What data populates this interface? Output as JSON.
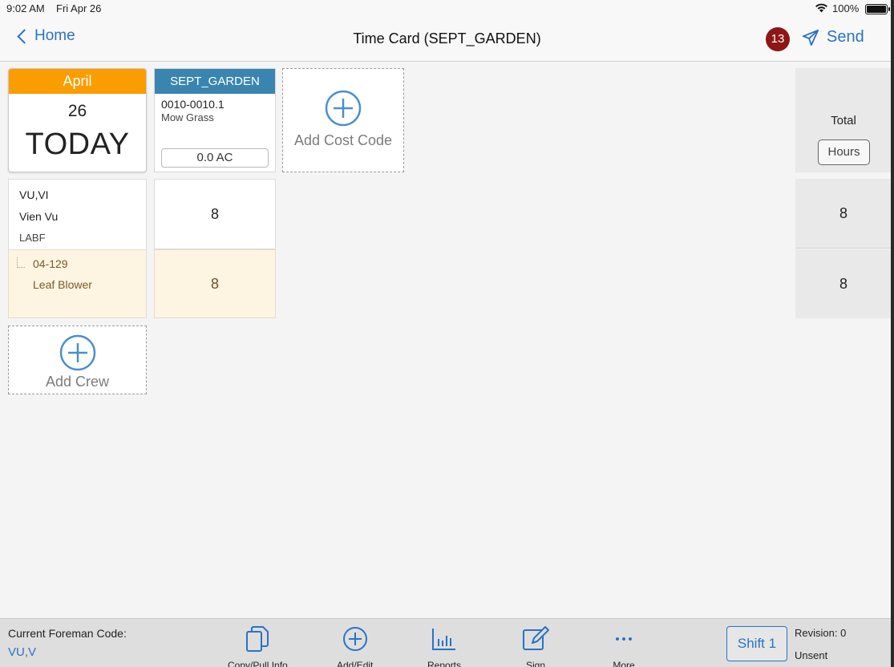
{
  "status": {
    "time": "9:02 AM",
    "date": "Fri Apr 26",
    "battery": "100%"
  },
  "nav": {
    "back_label": "Home",
    "title": "Time Card (SEPT_GARDEN)",
    "badge_count": "13",
    "send_label": "Send"
  },
  "date_card": {
    "month": "April",
    "day": "26",
    "today": "TODAY"
  },
  "cost_code": {
    "header": "SEPT_GARDEN",
    "code": "0010-0010.1",
    "description": "Mow Grass",
    "quantity": "0.0 AC"
  },
  "add_cost_code_label": "Add Cost Code",
  "total": {
    "title": "Total",
    "hours_button": "Hours",
    "crew_total": "8",
    "equipment_total": "8"
  },
  "crew": {
    "code": "VU,VI",
    "name": "Vien Vu",
    "class": "LABF",
    "hours": "8"
  },
  "equipment": {
    "id": "04-129",
    "name": "Leaf Blower",
    "hours": "8"
  },
  "add_crew_label": "Add Crew",
  "toolbar": {
    "foreman_label": "Current Foreman Code:",
    "foreman_value": "VU,V",
    "copy_label": "Copy/Pull Info",
    "addedit_label": "Add/Edit",
    "reports_label": "Reports",
    "sign_label": "Sign",
    "more_label": "More",
    "shift_label": "Shift 1",
    "revision": "Revision: 0",
    "sent_status": "Unsent"
  },
  "colors": {
    "accent": "#2a73c4",
    "month_header": "#fa9d00",
    "cost_code_header": "#3a85b0",
    "badge": "#8e1616",
    "equipment_row": "#fdf5e1"
  },
  "icons": [
    "chevron-left-icon",
    "send-icon",
    "plus-circle-icon",
    "copy-icon",
    "bar-chart-icon",
    "edit-icon",
    "more-icon",
    "wifi-icon",
    "battery-icon"
  ]
}
